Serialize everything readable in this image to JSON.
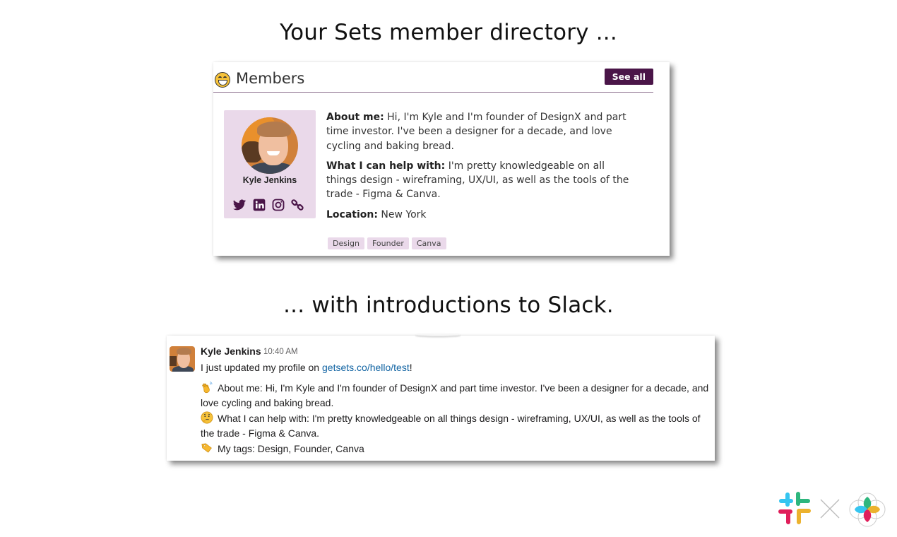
{
  "headings": {
    "top": "Your Sets member directory ...",
    "bottom": "... with introductions to Slack."
  },
  "members_card": {
    "title": "Members",
    "see_all_label": "See all",
    "profile": {
      "name": "Kyle Jenkins",
      "socials": [
        "twitter-icon",
        "linkedin-icon",
        "instagram-icon",
        "link-icon"
      ]
    },
    "about_label": "About me:",
    "about_text": " Hi, I'm Kyle and I'm founder of DesignX and part time investor. I've been a designer for a decade, and love cycling and baking bread.",
    "help_label": "What I can help with:",
    "help_text": " I'm pretty knowledgeable on all things design - wireframing, UX/UI, as well as the tools of the trade - Figma & Canva.",
    "location_label": "Location:",
    "location_text": " New York",
    "tags": [
      "Design",
      "Founder",
      "Canva"
    ],
    "accent_color": "#4a1548",
    "tag_bg": "#ead9ea"
  },
  "slack_message": {
    "sender": "Kyle Jenkins",
    "time": "10:40 AM",
    "intro_prefix": "I just updated my profile on ",
    "intro_link": "getsets.co/hello/test",
    "intro_suffix": "!",
    "about_line": "About me: Hi, I'm Kyle and I'm founder of DesignX and part time investor. I've been a designer for a decade, and love cycling and baking bread.",
    "help_line": "What I can help with: I'm pretty knowledgeable on all things design - wireframing, UX/UI, as well as the tools of the trade - Figma & Canva.",
    "tags_line": "My tags: Design, Founder, Canva",
    "link_color": "#1264a3"
  },
  "logos": [
    "slack-logo",
    "sets-logo"
  ]
}
